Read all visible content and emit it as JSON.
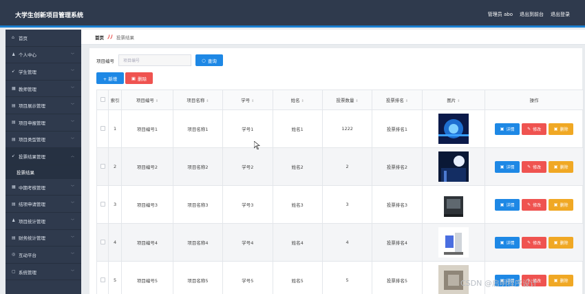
{
  "header": {
    "title": "大学生创新项目管理系统",
    "admin": "管理员 abo",
    "back": "退出到前台",
    "logout": "退出登录"
  },
  "sidebar": {
    "items": [
      {
        "icon": "home-icon",
        "label": "首页",
        "chev": ""
      },
      {
        "icon": "user-icon",
        "label": "个人中心",
        "chev": "v"
      },
      {
        "icon": "send-icon",
        "label": "学生管理",
        "chev": "v"
      },
      {
        "icon": "grid-icon",
        "label": "教师管理",
        "chev": "v"
      },
      {
        "icon": "doc-icon",
        "label": "项目展示管理",
        "chev": "v"
      },
      {
        "icon": "doc-icon",
        "label": "项目申报管理",
        "chev": "v"
      },
      {
        "icon": "doc-icon",
        "label": "项目类型管理",
        "chev": "v"
      },
      {
        "icon": "send-icon",
        "label": "投票结果管理",
        "chev": "^"
      }
    ],
    "sub": "投票结果",
    "items2": [
      {
        "icon": "grid-icon",
        "label": "中期考核管理",
        "chev": "v"
      },
      {
        "icon": "doc-icon",
        "label": "结项申请管理",
        "chev": "v"
      },
      {
        "icon": "user-icon",
        "label": "项目统计管理",
        "chev": "v"
      },
      {
        "icon": "doc-icon",
        "label": "财务统计管理",
        "chev": "v"
      },
      {
        "icon": "circle-icon",
        "label": "互动平台",
        "chev": "v"
      },
      {
        "icon": "chat-icon",
        "label": "系统管理",
        "chev": "v"
      }
    ]
  },
  "breadcrumb": {
    "home": "首页",
    "current": "投票结果"
  },
  "search": {
    "label": "项目编号",
    "placeholder": "项目编号",
    "button": "查询"
  },
  "toolbar": {
    "add": "+ 新增",
    "delete": "删除"
  },
  "table": {
    "headers": [
      "",
      "索引",
      "项目编号",
      "项目名称",
      "学号",
      "姓名",
      "投票数量",
      "投票排名",
      "图片",
      "操作"
    ],
    "rows": [
      [
        "1",
        "项目编号1",
        "项目名称1",
        "学号1",
        "姓名1",
        "1222",
        "投票排名1"
      ],
      [
        "2",
        "项目编号2",
        "项目名称2",
        "学号2",
        "姓名2",
        "2",
        "投票排名2"
      ],
      [
        "3",
        "项目编号3",
        "项目名称3",
        "学号3",
        "姓名3",
        "3",
        "投票排名3"
      ],
      [
        "4",
        "项目编号4",
        "项目名称4",
        "学号4",
        "姓名4",
        "4",
        "投票排名4"
      ],
      [
        "5",
        "项目编号5",
        "项目名称5",
        "学号5",
        "姓名5",
        "5",
        "投票排名5"
      ]
    ],
    "ops": {
      "detail": "详情",
      "edit": "修改",
      "delete": "删除"
    }
  },
  "watermark": "CSDN @启明程序设计",
  "colors": {
    "topbar": "#2f3a4d",
    "accent": "#1e88e5",
    "danger": "#ef5350",
    "warning": "#f0a824"
  }
}
